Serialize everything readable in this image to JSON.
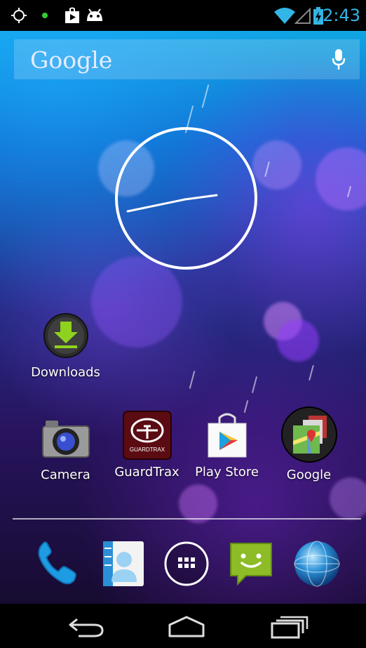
{
  "status_bar": {
    "time": "2:43",
    "accent_color": "#33b5e5",
    "icons": [
      "gps-icon",
      "notification-dot-icon",
      "play-store-notification-icon",
      "android-debug-icon",
      "wifi-icon",
      "signal-icon",
      "battery-charging-icon"
    ]
  },
  "search_bar": {
    "label": "Google",
    "icon": "microphone-icon"
  },
  "widget": {
    "type": "analog-clock",
    "time_shown": "2:43"
  },
  "apps": [
    {
      "label": "Downloads",
      "icon": "download-icon"
    },
    {
      "label": "Camera",
      "icon": "camera-icon"
    },
    {
      "label": "GuardTrax",
      "icon": "guardtrax-icon"
    },
    {
      "label": "Play Store",
      "icon": "play-store-icon"
    },
    {
      "label": "Google",
      "icon": "google-maps-folder-icon"
    }
  ],
  "guardtrax_logo_text": "GUARDTRAX",
  "dock": [
    {
      "name": "phone",
      "icon": "phone-icon"
    },
    {
      "name": "contacts",
      "icon": "contacts-icon"
    },
    {
      "name": "all-apps",
      "icon": "app-drawer-icon"
    },
    {
      "name": "messaging",
      "icon": "messaging-icon"
    },
    {
      "name": "browser",
      "icon": "globe-icon"
    }
  ],
  "nav_bar": {
    "buttons": [
      "back-icon",
      "home-icon",
      "recents-icon"
    ]
  }
}
